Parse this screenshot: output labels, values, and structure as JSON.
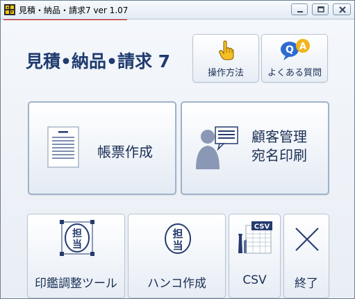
{
  "window": {
    "title": "見積・納品・請求7 ver 1.07",
    "controls": [
      "minimize",
      "maximize",
      "close"
    ]
  },
  "app": {
    "logo_text": "見積•納品•請求 7"
  },
  "toolbar": {
    "howto_label": "操作方法",
    "faq_label": "よくある質問",
    "faq_badge_q": "Q",
    "faq_badge_a": "A"
  },
  "tiles": {
    "forms_label": "帳票作成",
    "customer_label_line1": "顧客管理",
    "customer_label_line2": "宛名印刷",
    "stamp_adjust_label": "印鑑調整ツール",
    "stamp_create_label": "ハンコ作成",
    "csv_label": "CSV",
    "csv_badge": "CSV",
    "exit_label": "終了",
    "stamp_text_top": "担",
    "stamp_text_bottom": "当"
  },
  "icons": {
    "app": "app-grid-icon",
    "howto": "hand-pointer-icon",
    "faq": "qa-bubble-icon",
    "forms": "document-icon",
    "customer": "person-message-icon",
    "stamp_adjust": "stamp-crop-icon",
    "stamp_create": "stamp-icon",
    "csv": "csv-tools-icon",
    "exit": "close-x-icon"
  },
  "colors": {
    "accent_red": "#d40000",
    "logo_navy": "#1f3b6f",
    "label_navy": "#1b2f55",
    "icon_navy": "#243a6e",
    "faq_blue": "#2e6bd0",
    "faq_yellow": "#f2b51d"
  }
}
